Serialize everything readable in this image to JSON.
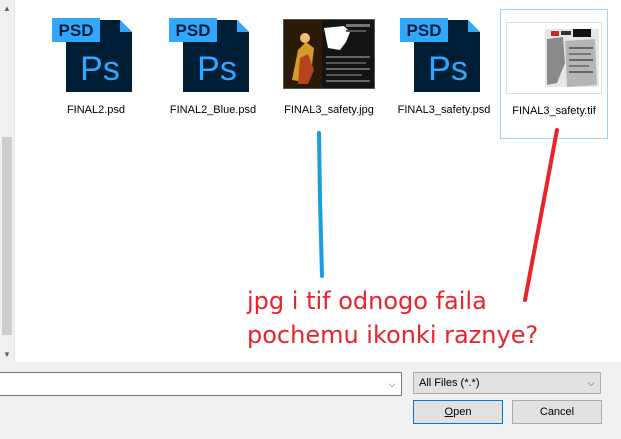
{
  "files": [
    {
      "name": "FINAL2.psd",
      "type": "psd",
      "icon": "photoshop-file-icon",
      "badge": "PSD",
      "logo": "Ps"
    },
    {
      "name": "FINAL2_Blue.psd",
      "type": "psd",
      "icon": "photoshop-file-icon",
      "badge": "PSD",
      "logo": "Ps"
    },
    {
      "name": "FINAL3_safety.jpg",
      "type": "jpg",
      "icon": "jpg-thumbnail"
    },
    {
      "name": "FINAL3_safety.psd",
      "type": "psd",
      "icon": "photoshop-file-icon",
      "badge": "PSD",
      "logo": "Ps"
    },
    {
      "name": "FINAL3_safety.tif",
      "type": "tif",
      "icon": "tif-thumbnail",
      "selected": true
    }
  ],
  "annotation": {
    "line1": "jpg i tif odnogo faila",
    "line2": "pochemu ikonki raznye?",
    "text_color": "#e8232a",
    "arrow_blue": "#1a9de0",
    "arrow_red": "#e8232a"
  },
  "bottom": {
    "filename_value": "",
    "filetype": "All Files (*.*)",
    "open_label_u": "O",
    "open_label_rest": "pen",
    "cancel_label": "Cancel"
  },
  "colors": {
    "psd_bg": "#001e36",
    "psd_accent": "#31a8ff",
    "selection_border": "#99d1ff"
  }
}
